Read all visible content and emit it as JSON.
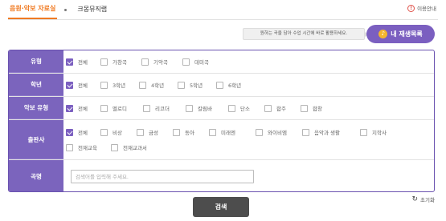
{
  "tabs": [
    {
      "label": "음원·악보 자료실",
      "active": true
    },
    {
      "label": "크몽뮤직랩",
      "active": false
    }
  ],
  "guide": {
    "label": "이용안내",
    "icon": "exclamation-icon"
  },
  "playlist": {
    "tooltip": "원하는 곡을 담아 수업 시간에 바로 활용하세요.",
    "button_label": "내 재생목록",
    "icon": "music-note-icon"
  },
  "filters": [
    {
      "key": "type",
      "label": "유형",
      "options": [
        {
          "label": "전체",
          "checked": true
        },
        {
          "label": "가창곡",
          "checked": false
        },
        {
          "label": "기악곡",
          "checked": false
        },
        {
          "label": "데미곡",
          "checked": false
        }
      ]
    },
    {
      "key": "grade",
      "label": "학년",
      "options": [
        {
          "label": "전체",
          "checked": true
        },
        {
          "label": "3학년",
          "checked": false
        },
        {
          "label": "4학년",
          "checked": false
        },
        {
          "label": "5학년",
          "checked": false
        },
        {
          "label": "6학년",
          "checked": false
        }
      ]
    },
    {
      "key": "score-type",
      "label": "악보 유형",
      "options": [
        {
          "label": "전체",
          "checked": true
        },
        {
          "label": "멜로디",
          "checked": false
        },
        {
          "label": "리코더",
          "checked": false
        },
        {
          "label": "칼림바",
          "checked": false
        },
        {
          "label": "단소",
          "checked": false
        },
        {
          "label": "합주",
          "checked": false
        },
        {
          "label": "합창",
          "checked": false
        }
      ]
    },
    {
      "key": "publisher",
      "label": "출판사",
      "options": [
        {
          "label": "전체",
          "checked": true
        },
        {
          "label": "비상",
          "checked": false
        },
        {
          "label": "금성",
          "checked": false
        },
        {
          "label": "동아",
          "checked": false
        },
        {
          "label": "미래엔",
          "checked": false
        },
        {
          "label": "와이비엠",
          "checked": false
        },
        {
          "label": "음악과 생활",
          "checked": false
        },
        {
          "label": "지학사",
          "checked": false
        },
        {
          "label": "천재교육",
          "checked": false
        },
        {
          "label": "천재교과서",
          "checked": false
        }
      ]
    }
  ],
  "song": {
    "label": "곡명",
    "placeholder": "검색어를 입력해 주세요."
  },
  "reset_label": "초기화",
  "search_label": "검색",
  "colors": {
    "accent_orange": "#f07a22",
    "purple": "#7b5fc0",
    "label_bg": "#7b64bd",
    "dark_button": "#4d4d4d"
  }
}
